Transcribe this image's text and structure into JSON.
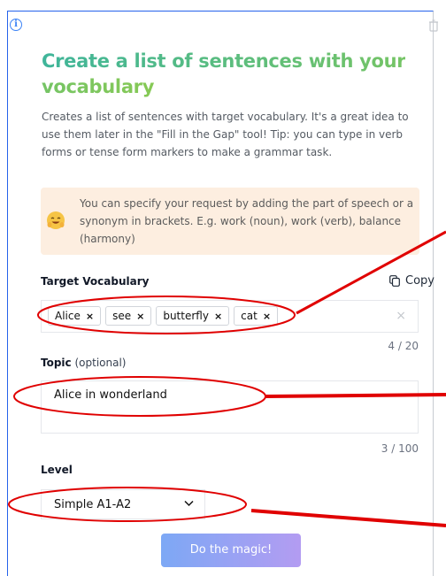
{
  "header": {
    "info_icon": "info-circle-icon",
    "info_glyph": "i",
    "delete_icon": "trash-icon"
  },
  "title": "Create a list of sentences with your vocabulary",
  "description": "Creates a list of sentences with target vocabulary. It's a great idea to use them later in the \"Fill in the Gap\" tool! Tip: you can type in verb forms or tense form markers to make a grammar task.",
  "tip": {
    "emoji": "smiling-emoji-icon",
    "text": "You can specify your request by adding the part of speech or a synonym in brackets. E.g. work (noun), work (verb), balance (harmony)"
  },
  "vocabulary": {
    "label": "Target Vocabulary",
    "copy_label": "Copy",
    "tags": [
      "Alice",
      "see",
      "butterfly",
      "cat"
    ],
    "remove_glyph": "×",
    "clear_glyph": "×",
    "counter": "4 / 20"
  },
  "topic": {
    "label": "Topic",
    "optional": " (optional)",
    "value": "Alice in wonderland",
    "counter": "3 / 100"
  },
  "level": {
    "label": "Level",
    "value": "Simple A1-A2"
  },
  "submit_label": "Do the magic!",
  "colors": {
    "title_gradient_start": "#3fb59a",
    "title_gradient_end": "#86c955",
    "tip_background": "#fdeee0",
    "button_gradient_start": "#7da8f5",
    "button_gradient_end": "#b39cf2",
    "annotation_red": "#e00000"
  }
}
